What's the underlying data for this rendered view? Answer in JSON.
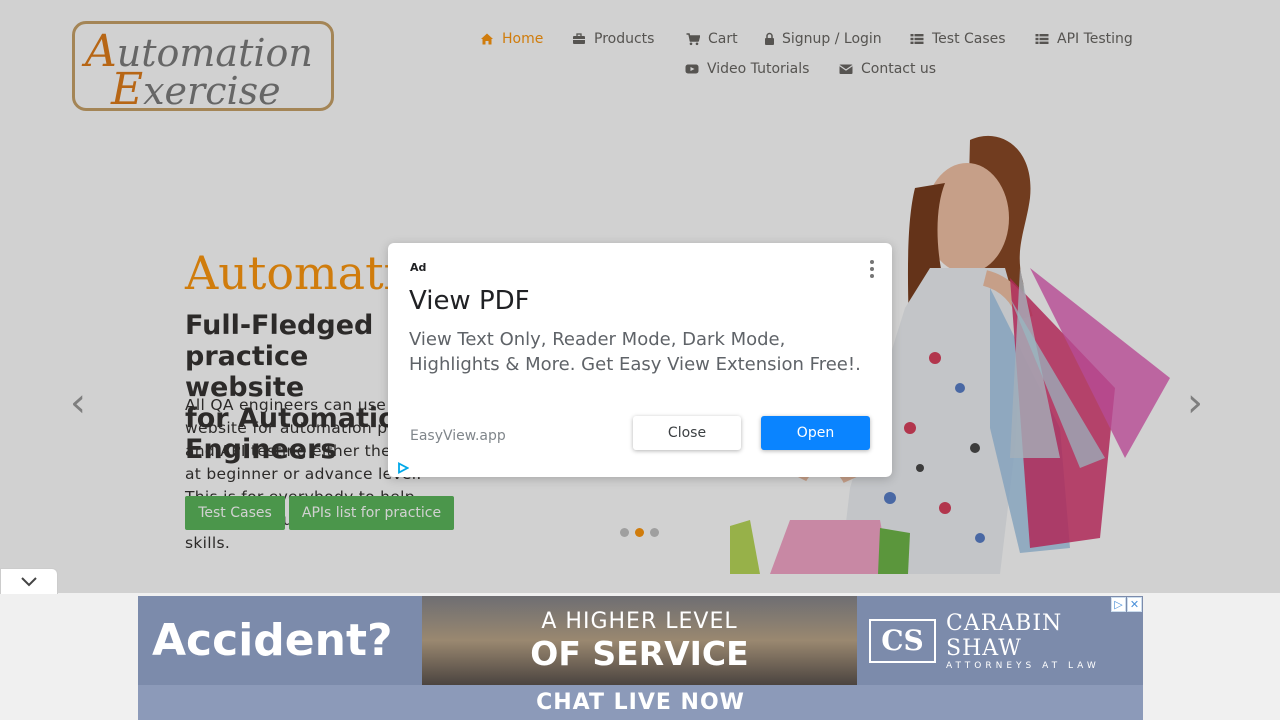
{
  "logo": {
    "line1_cap": "A",
    "line1_rest": "utomation",
    "line2_cap": "E",
    "line2_rest": "xercise"
  },
  "nav": {
    "items": [
      {
        "label": "Home",
        "icon": "home-icon",
        "active": true
      },
      {
        "label": "Products",
        "icon": "briefcase-icon"
      },
      {
        "label": "Cart",
        "icon": "cart-icon"
      },
      {
        "label": "Signup / Login",
        "icon": "lock-icon"
      },
      {
        "label": "Test Cases",
        "icon": "list-icon"
      },
      {
        "label": "API Testing",
        "icon": "list-icon"
      },
      {
        "label": "Video Tutorials",
        "icon": "youtube-play-icon"
      },
      {
        "label": "Contact us",
        "icon": "envelope-icon"
      }
    ]
  },
  "hero": {
    "title": "AutomationExercise",
    "subtitle": "Full-Fledged practice website\nfor Automation Engineers",
    "description": "All QA engineers can use this website for automation practice and API testing either they are at beginner or advance level. This is for everybody to help them brush up their automation skills.",
    "btn_test_cases": "Test Cases",
    "btn_apis": "APIs list for practice",
    "prev_arrow": "‹",
    "next_arrow": "›"
  },
  "modal": {
    "ad_label": "Ad",
    "title": "View PDF",
    "body": "View Text Only, Reader Mode, Dark Mode, Highlights & More. Get Easy View Extension Free!.",
    "site": "EasyView.app",
    "close_label": "Close",
    "open_label": "Open"
  },
  "banner": {
    "left_text": "Accident?",
    "mid_line1": "A HIGHER LEVEL",
    "mid_line2": "OF SERVICE",
    "cs_logo": "CS",
    "firm_name": "CARABIN SHAW",
    "firm_sub": "ATTORNEYS AT LAW",
    "cta": "CHAT LIVE NOW"
  },
  "colors": {
    "accent": "#fe980f",
    "button_green": "#5cb85c",
    "open_blue": "#0a84ff"
  }
}
